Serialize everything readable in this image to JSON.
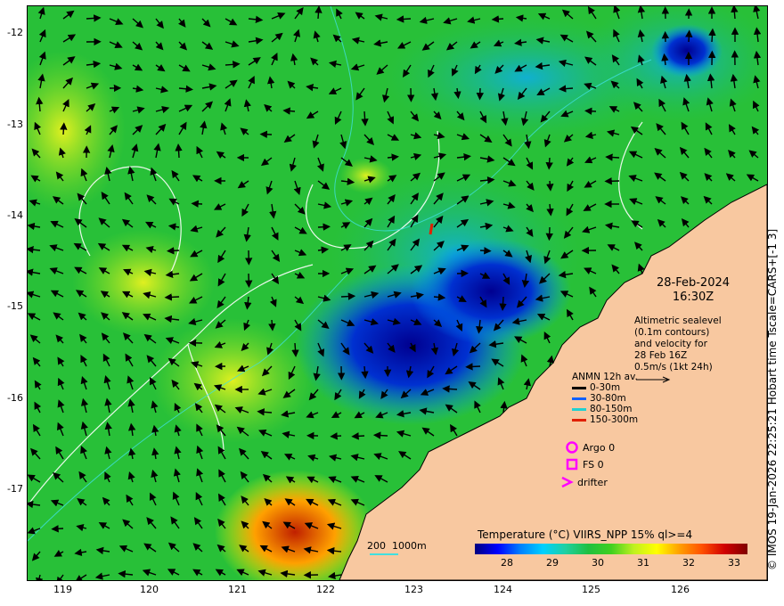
{
  "date": "28-Feb-2024",
  "time": "16:30Z",
  "altimetry_note": [
    "Altimetric sealevel",
    "(0.1m contours)",
    "and velocity for",
    "28 Feb 16Z",
    "0.5m/s (1kt 24h)"
  ],
  "anmn_legend": {
    "title": "ANMN 12h av.",
    "items": [
      {
        "label": "0-30m",
        "color": "#000000"
      },
      {
        "label": "30-80m",
        "color": "#1060ff"
      },
      {
        "label": "80-150m",
        "color": "#20d0d0"
      },
      {
        "label": "150-300m",
        "color": "#e02000"
      }
    ]
  },
  "symbols": [
    {
      "label": "Argo 0",
      "shape": "circle",
      "color": "#ff00ff"
    },
    {
      "label": "FS 0",
      "shape": "square",
      "color": "#ff00ff"
    },
    {
      "label": "drifter",
      "shape": "chevron",
      "color": "#ff00ff"
    }
  ],
  "colorbar": {
    "title": "Temperature (°C) VIIRS_NPP 15% ql>=4",
    "ticks": [
      "28",
      "29",
      "30",
      "31",
      "32",
      "33"
    ]
  },
  "scale_bar": "200  1000m",
  "side_caption": "© IMOS 19-Jan-2026 22:25:21 Hobart time Tscale=CARS+[-1 3]",
  "axes": {
    "lat_labels": [
      "-12",
      "-13",
      "-14",
      "-15",
      "-16",
      "-17"
    ],
    "lon_labels": [
      "119",
      "120",
      "121",
      "122",
      "123",
      "124",
      "125",
      "126"
    ]
  }
}
